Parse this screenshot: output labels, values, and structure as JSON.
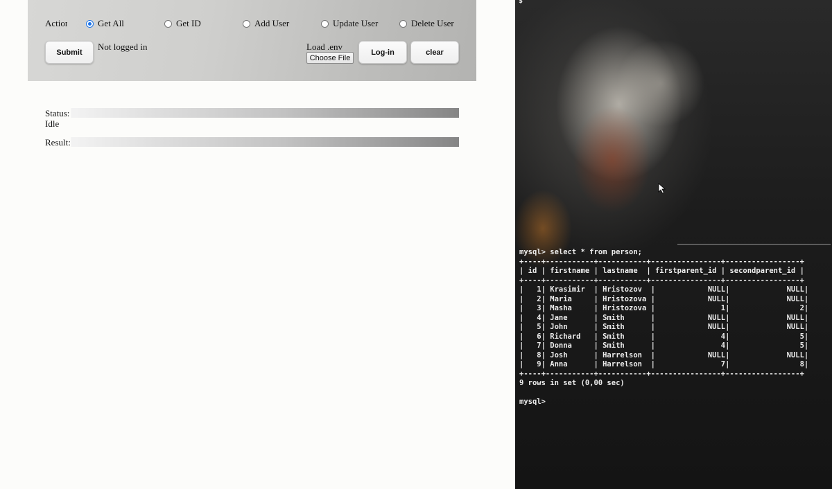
{
  "form": {
    "action_label": "Action",
    "radio_options": [
      {
        "label": "Get All",
        "checked": true
      },
      {
        "label": "Get ID",
        "checked": false
      },
      {
        "label": "Add User",
        "checked": false
      },
      {
        "label": "Update User",
        "checked": false
      },
      {
        "label": "Delete User",
        "checked": false
      }
    ],
    "submit_label": "Submit",
    "login_status": "Not logged in",
    "load_env_label": "Load .env",
    "choose_file_label": "Choose File",
    "login_label": "Log-in",
    "clear_label": "clear"
  },
  "status": {
    "label": "Status:",
    "value": "Idle"
  },
  "result": {
    "label": "Result:"
  },
  "terminal": {
    "top_prompt": "$",
    "command_line": "mysql> select * from person;",
    "border_line": "+----+-----------+-----------+----------------+-----------------+",
    "header_line": "| id | firstname | lastname  | firstparent_id | secondparent_id |",
    "columns": [
      "id",
      "firstname",
      "lastname",
      "firstparent_id",
      "secondparent_id"
    ],
    "rows": [
      [
        "1",
        "Krasimir",
        "Hristozov",
        "NULL",
        "NULL"
      ],
      [
        "2",
        "Maria",
        "Hristozova",
        "NULL",
        "NULL"
      ],
      [
        "3",
        "Masha",
        "Hristozova",
        "1",
        "2"
      ],
      [
        "4",
        "Jane",
        "Smith",
        "NULL",
        "NULL"
      ],
      [
        "5",
        "John",
        "Smith",
        "NULL",
        "NULL"
      ],
      [
        "6",
        "Richard",
        "Smith",
        "4",
        "5"
      ],
      [
        "7",
        "Donna",
        "Smith",
        "4",
        "5"
      ],
      [
        "8",
        "Josh",
        "Harrelson",
        "NULL",
        "NULL"
      ],
      [
        "9",
        "Anna",
        "Harrelson",
        "7",
        "8"
      ]
    ],
    "summary": "9 rows in set (0,00 sec)",
    "final_prompt": "mysql>"
  }
}
